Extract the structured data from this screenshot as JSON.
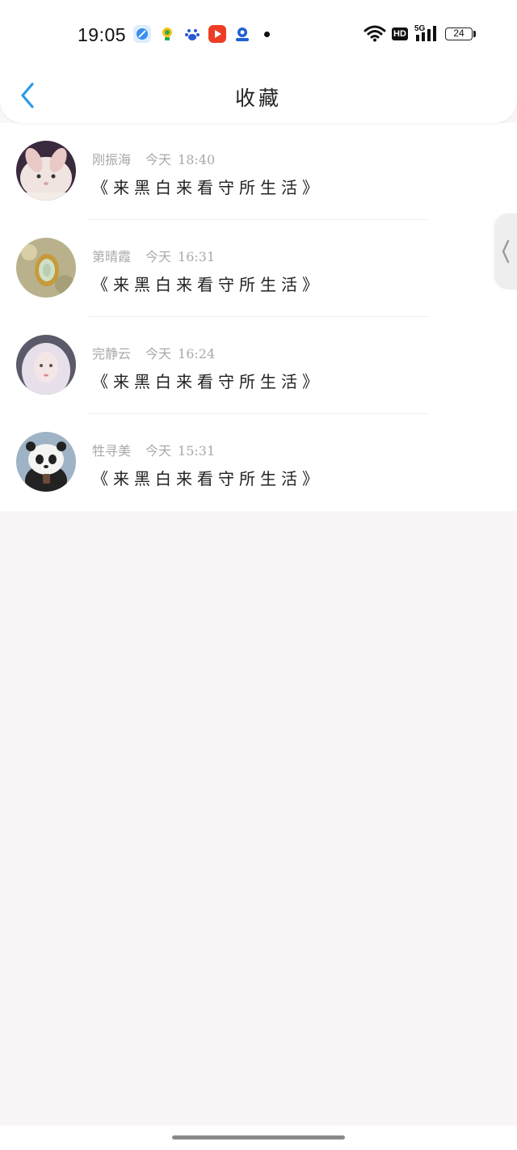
{
  "status_bar": {
    "time": "19:05",
    "app_icons": [
      "browser-icon",
      "qq-music-icon",
      "baidu-icon",
      "video-play-icon",
      "maps-icon"
    ],
    "network": "5G",
    "hd_label": "HD",
    "battery": "24"
  },
  "header": {
    "title": "收藏",
    "back_icon": "chevron-left-icon"
  },
  "favorites": [
    {
      "name": "刚振海",
      "time_label": "今天",
      "time": "18:40",
      "text": "《来黑白来看守所生活》",
      "avatar": "rabbit-avatar"
    },
    {
      "name": "第晴霞",
      "time_label": "今天",
      "time": "16:31",
      "text": "《来黑白来看守所生活》",
      "avatar": "pendant-avatar"
    },
    {
      "name": "完静云",
      "time_label": "今天",
      "time": "16:24",
      "text": "《来黑白来看守所生活》",
      "avatar": "girl-avatar"
    },
    {
      "name": "牲寻美",
      "time_label": "今天",
      "time": "15:31",
      "text": "《来黑白来看守所生活》",
      "avatar": "panda-avatar"
    }
  ],
  "side_handle_icon": "chevron-left-icon",
  "colors": {
    "accent": "#2a9be5",
    "background": "#f8f6f7",
    "meta_text": "#a9a9a9"
  }
}
